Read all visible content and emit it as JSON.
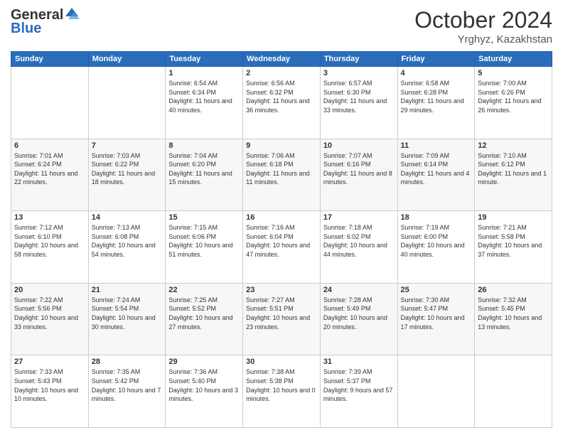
{
  "header": {
    "logo_general": "General",
    "logo_blue": "Blue",
    "month_title": "October 2024",
    "location": "Yrghyz, Kazakhstan"
  },
  "days_of_week": [
    "Sunday",
    "Monday",
    "Tuesday",
    "Wednesday",
    "Thursday",
    "Friday",
    "Saturday"
  ],
  "weeks": [
    [
      {
        "day": "",
        "sunrise": "",
        "sunset": "",
        "daylight": ""
      },
      {
        "day": "",
        "sunrise": "",
        "sunset": "",
        "daylight": ""
      },
      {
        "day": "1",
        "sunrise": "Sunrise: 6:54 AM",
        "sunset": "Sunset: 6:34 PM",
        "daylight": "Daylight: 11 hours and 40 minutes."
      },
      {
        "day": "2",
        "sunrise": "Sunrise: 6:56 AM",
        "sunset": "Sunset: 6:32 PM",
        "daylight": "Daylight: 11 hours and 36 minutes."
      },
      {
        "day": "3",
        "sunrise": "Sunrise: 6:57 AM",
        "sunset": "Sunset: 6:30 PM",
        "daylight": "Daylight: 11 hours and 33 minutes."
      },
      {
        "day": "4",
        "sunrise": "Sunrise: 6:58 AM",
        "sunset": "Sunset: 6:28 PM",
        "daylight": "Daylight: 11 hours and 29 minutes."
      },
      {
        "day": "5",
        "sunrise": "Sunrise: 7:00 AM",
        "sunset": "Sunset: 6:26 PM",
        "daylight": "Daylight: 11 hours and 26 minutes."
      }
    ],
    [
      {
        "day": "6",
        "sunrise": "Sunrise: 7:01 AM",
        "sunset": "Sunset: 6:24 PM",
        "daylight": "Daylight: 11 hours and 22 minutes."
      },
      {
        "day": "7",
        "sunrise": "Sunrise: 7:03 AM",
        "sunset": "Sunset: 6:22 PM",
        "daylight": "Daylight: 11 hours and 18 minutes."
      },
      {
        "day": "8",
        "sunrise": "Sunrise: 7:04 AM",
        "sunset": "Sunset: 6:20 PM",
        "daylight": "Daylight: 11 hours and 15 minutes."
      },
      {
        "day": "9",
        "sunrise": "Sunrise: 7:06 AM",
        "sunset": "Sunset: 6:18 PM",
        "daylight": "Daylight: 11 hours and 11 minutes."
      },
      {
        "day": "10",
        "sunrise": "Sunrise: 7:07 AM",
        "sunset": "Sunset: 6:16 PM",
        "daylight": "Daylight: 11 hours and 8 minutes."
      },
      {
        "day": "11",
        "sunrise": "Sunrise: 7:09 AM",
        "sunset": "Sunset: 6:14 PM",
        "daylight": "Daylight: 11 hours and 4 minutes."
      },
      {
        "day": "12",
        "sunrise": "Sunrise: 7:10 AM",
        "sunset": "Sunset: 6:12 PM",
        "daylight": "Daylight: 11 hours and 1 minute."
      }
    ],
    [
      {
        "day": "13",
        "sunrise": "Sunrise: 7:12 AM",
        "sunset": "Sunset: 6:10 PM",
        "daylight": "Daylight: 10 hours and 58 minutes."
      },
      {
        "day": "14",
        "sunrise": "Sunrise: 7:13 AM",
        "sunset": "Sunset: 6:08 PM",
        "daylight": "Daylight: 10 hours and 54 minutes."
      },
      {
        "day": "15",
        "sunrise": "Sunrise: 7:15 AM",
        "sunset": "Sunset: 6:06 PM",
        "daylight": "Daylight: 10 hours and 51 minutes."
      },
      {
        "day": "16",
        "sunrise": "Sunrise: 7:16 AM",
        "sunset": "Sunset: 6:04 PM",
        "daylight": "Daylight: 10 hours and 47 minutes."
      },
      {
        "day": "17",
        "sunrise": "Sunrise: 7:18 AM",
        "sunset": "Sunset: 6:02 PM",
        "daylight": "Daylight: 10 hours and 44 minutes."
      },
      {
        "day": "18",
        "sunrise": "Sunrise: 7:19 AM",
        "sunset": "Sunset: 6:00 PM",
        "daylight": "Daylight: 10 hours and 40 minutes."
      },
      {
        "day": "19",
        "sunrise": "Sunrise: 7:21 AM",
        "sunset": "Sunset: 5:58 PM",
        "daylight": "Daylight: 10 hours and 37 minutes."
      }
    ],
    [
      {
        "day": "20",
        "sunrise": "Sunrise: 7:22 AM",
        "sunset": "Sunset: 5:56 PM",
        "daylight": "Daylight: 10 hours and 33 minutes."
      },
      {
        "day": "21",
        "sunrise": "Sunrise: 7:24 AM",
        "sunset": "Sunset: 5:54 PM",
        "daylight": "Daylight: 10 hours and 30 minutes."
      },
      {
        "day": "22",
        "sunrise": "Sunrise: 7:25 AM",
        "sunset": "Sunset: 5:52 PM",
        "daylight": "Daylight: 10 hours and 27 minutes."
      },
      {
        "day": "23",
        "sunrise": "Sunrise: 7:27 AM",
        "sunset": "Sunset: 5:51 PM",
        "daylight": "Daylight: 10 hours and 23 minutes."
      },
      {
        "day": "24",
        "sunrise": "Sunrise: 7:28 AM",
        "sunset": "Sunset: 5:49 PM",
        "daylight": "Daylight: 10 hours and 20 minutes."
      },
      {
        "day": "25",
        "sunrise": "Sunrise: 7:30 AM",
        "sunset": "Sunset: 5:47 PM",
        "daylight": "Daylight: 10 hours and 17 minutes."
      },
      {
        "day": "26",
        "sunrise": "Sunrise: 7:32 AM",
        "sunset": "Sunset: 5:45 PM",
        "daylight": "Daylight: 10 hours and 13 minutes."
      }
    ],
    [
      {
        "day": "27",
        "sunrise": "Sunrise: 7:33 AM",
        "sunset": "Sunset: 5:43 PM",
        "daylight": "Daylight: 10 hours and 10 minutes."
      },
      {
        "day": "28",
        "sunrise": "Sunrise: 7:35 AM",
        "sunset": "Sunset: 5:42 PM",
        "daylight": "Daylight: 10 hours and 7 minutes."
      },
      {
        "day": "29",
        "sunrise": "Sunrise: 7:36 AM",
        "sunset": "Sunset: 5:40 PM",
        "daylight": "Daylight: 10 hours and 3 minutes."
      },
      {
        "day": "30",
        "sunrise": "Sunrise: 7:38 AM",
        "sunset": "Sunset: 5:38 PM",
        "daylight": "Daylight: 10 hours and 0 minutes."
      },
      {
        "day": "31",
        "sunrise": "Sunrise: 7:39 AM",
        "sunset": "Sunset: 5:37 PM",
        "daylight": "Daylight: 9 hours and 57 minutes."
      },
      {
        "day": "",
        "sunrise": "",
        "sunset": "",
        "daylight": ""
      },
      {
        "day": "",
        "sunrise": "",
        "sunset": "",
        "daylight": ""
      }
    ]
  ]
}
